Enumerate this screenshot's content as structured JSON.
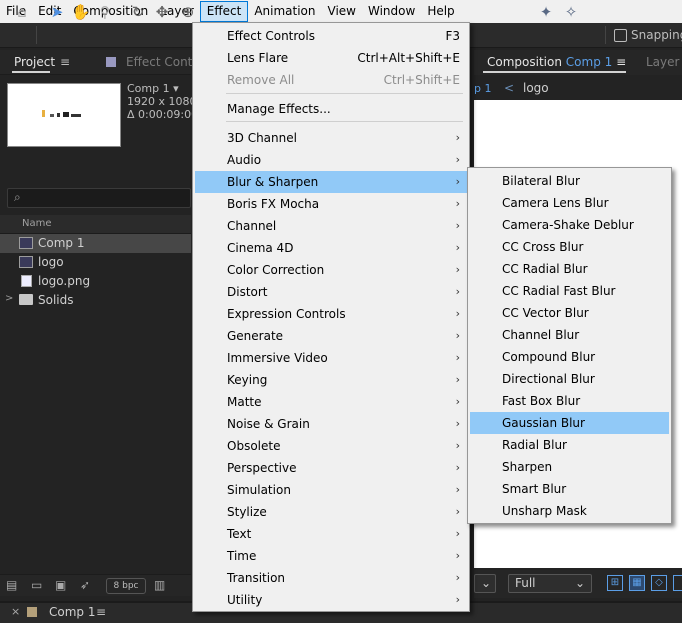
{
  "menubar": {
    "items": [
      "File",
      "Edit",
      "Composition",
      "Layer",
      "Effect",
      "Animation",
      "View",
      "Window",
      "Help"
    ],
    "active_index": 4
  },
  "toolbar": {
    "snapping_label": "Snapping",
    "icons": [
      "home-icon",
      "selection-tool-icon",
      "hand-tool-icon",
      "zoom-tool-icon",
      "rotate-tool-icon",
      "move-tool-icon"
    ]
  },
  "project_panel": {
    "tab_label": "Project",
    "tab_menu": "≡",
    "effect_controls_tab": "Effect Control",
    "selected_comp_name": "Comp 1",
    "selected_comp_arrow": "▾",
    "dimensions": "1920 x 1080 (",
    "duration": "Δ 0:00:09:00, ",
    "search_glyph": "⌕",
    "column_name": "Name",
    "items": [
      {
        "name": "Comp 1",
        "type": "comp",
        "selected": true
      },
      {
        "name": "logo",
        "type": "comp",
        "selected": false
      },
      {
        "name": "logo.png",
        "type": "file",
        "selected": false
      },
      {
        "name": "Solids",
        "type": "folder",
        "selected": false
      }
    ],
    "bpc_label": "8 bpc"
  },
  "composition_panel": {
    "tab_prefix": "Composition",
    "tab_comp": "Comp 1",
    "tab_menu": "≡",
    "layer_tab": "Layer",
    "crumb_comp": "p 1",
    "crumb_sep": "<",
    "crumb_logo": "logo",
    "resolution": "Full",
    "resolution_arrow": "⌄"
  },
  "timeline": {
    "close_glyph": "×",
    "label": "Comp 1",
    "menu": "≡"
  },
  "effect_menu": {
    "items": [
      {
        "label": "Effect Controls",
        "shortcut": "F3",
        "submenu": false,
        "disabled": false
      },
      {
        "label": "Lens Flare",
        "shortcut": "Ctrl+Alt+Shift+E",
        "submenu": false,
        "disabled": false
      },
      {
        "label": "Remove All",
        "shortcut": "Ctrl+Shift+E",
        "submenu": false,
        "disabled": true
      },
      {
        "label": "Manage Effects...",
        "shortcut": "",
        "submenu": false,
        "disabled": false
      },
      {
        "label": "3D Channel",
        "shortcut": "",
        "submenu": true,
        "disabled": false
      },
      {
        "label": "Audio",
        "shortcut": "",
        "submenu": true,
        "disabled": false
      },
      {
        "label": "Blur & Sharpen",
        "shortcut": "",
        "submenu": true,
        "disabled": false,
        "highlighted": true
      },
      {
        "label": "Boris FX Mocha",
        "shortcut": "",
        "submenu": true,
        "disabled": false
      },
      {
        "label": "Channel",
        "shortcut": "",
        "submenu": true,
        "disabled": false
      },
      {
        "label": "Cinema 4D",
        "shortcut": "",
        "submenu": true,
        "disabled": false
      },
      {
        "label": "Color Correction",
        "shortcut": "",
        "submenu": true,
        "disabled": false
      },
      {
        "label": "Distort",
        "shortcut": "",
        "submenu": true,
        "disabled": false
      },
      {
        "label": "Expression Controls",
        "shortcut": "",
        "submenu": true,
        "disabled": false
      },
      {
        "label": "Generate",
        "shortcut": "",
        "submenu": true,
        "disabled": false
      },
      {
        "label": "Immersive Video",
        "shortcut": "",
        "submenu": true,
        "disabled": false
      },
      {
        "label": "Keying",
        "shortcut": "",
        "submenu": true,
        "disabled": false
      },
      {
        "label": "Matte",
        "shortcut": "",
        "submenu": true,
        "disabled": false
      },
      {
        "label": "Noise & Grain",
        "shortcut": "",
        "submenu": true,
        "disabled": false
      },
      {
        "label": "Obsolete",
        "shortcut": "",
        "submenu": true,
        "disabled": false
      },
      {
        "label": "Perspective",
        "shortcut": "",
        "submenu": true,
        "disabled": false
      },
      {
        "label": "Simulation",
        "shortcut": "",
        "submenu": true,
        "disabled": false
      },
      {
        "label": "Stylize",
        "shortcut": "",
        "submenu": true,
        "disabled": false
      },
      {
        "label": "Text",
        "shortcut": "",
        "submenu": true,
        "disabled": false
      },
      {
        "label": "Time",
        "shortcut": "",
        "submenu": true,
        "disabled": false
      },
      {
        "label": "Transition",
        "shortcut": "",
        "submenu": true,
        "disabled": false
      },
      {
        "label": "Utility",
        "shortcut": "",
        "submenu": true,
        "disabled": false
      }
    ]
  },
  "blur_submenu": {
    "items": [
      {
        "label": "Bilateral Blur"
      },
      {
        "label": "Camera Lens Blur"
      },
      {
        "label": "Camera-Shake Deblur"
      },
      {
        "label": "CC Cross Blur"
      },
      {
        "label": "CC Radial Blur"
      },
      {
        "label": "CC Radial Fast Blur"
      },
      {
        "label": "CC Vector Blur"
      },
      {
        "label": "Channel Blur"
      },
      {
        "label": "Compound Blur"
      },
      {
        "label": "Directional Blur"
      },
      {
        "label": "Fast Box Blur"
      },
      {
        "label": "Gaussian Blur",
        "highlighted": true
      },
      {
        "label": "Radial Blur"
      },
      {
        "label": "Sharpen"
      },
      {
        "label": "Smart Blur"
      },
      {
        "label": "Unsharp Mask"
      }
    ]
  },
  "colors": {
    "menu_bg": "#f0f0f0",
    "menu_highlight": "#91c9f7",
    "accent_blue": "#5b9ee6",
    "panel_bg": "#232323"
  }
}
